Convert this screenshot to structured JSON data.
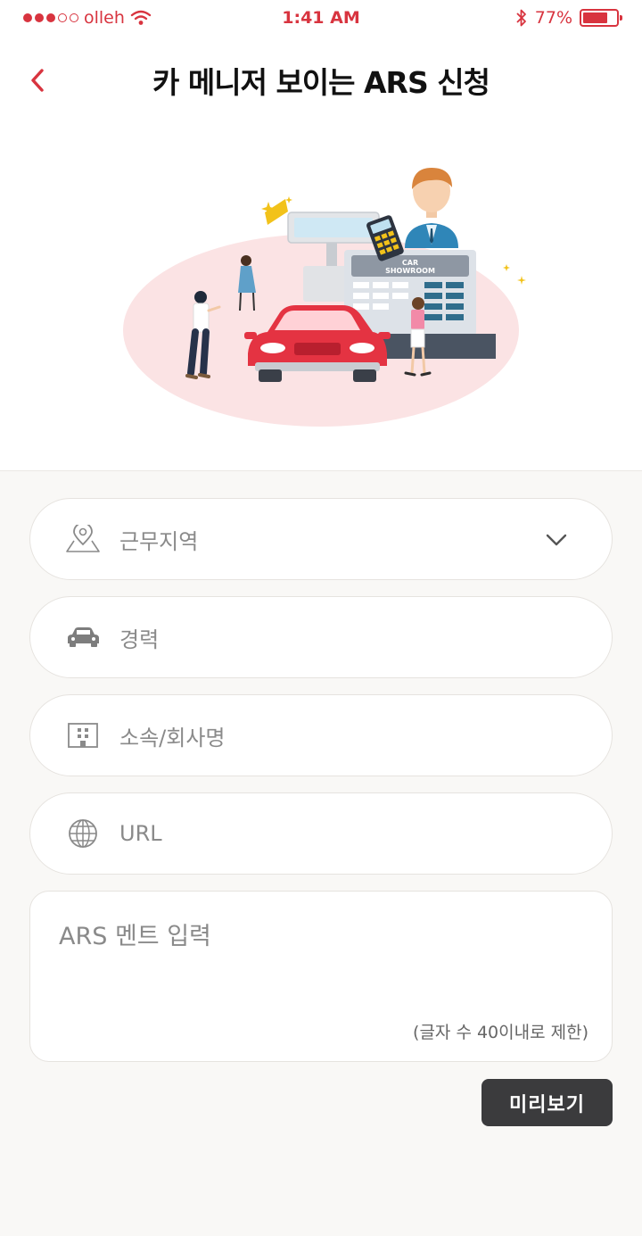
{
  "status_bar": {
    "carrier": "olleh",
    "time": "1:41 AM",
    "battery": "77%",
    "battery_level": 0.77
  },
  "header": {
    "title": "카 메니저 보이는 ARS 신청",
    "back_icon": "chevron-left-icon"
  },
  "illustration": {
    "sign_line1": "CAR",
    "sign_line2": "SHOWROOM"
  },
  "form": {
    "region_label": "근무지역",
    "career_label": "경력",
    "company_label": "소속/회사명",
    "url_label": "URL",
    "ars_placeholder": "ARS 멘트 입력",
    "char_limit": "(글자 수 40이내로 제한)"
  },
  "buttons": {
    "preview": "미리보기"
  },
  "colors": {
    "accent": "#d8343f",
    "button_dark": "#3b3b3d",
    "field_text": "#8a8a8a",
    "background": "#f9f8f6"
  }
}
